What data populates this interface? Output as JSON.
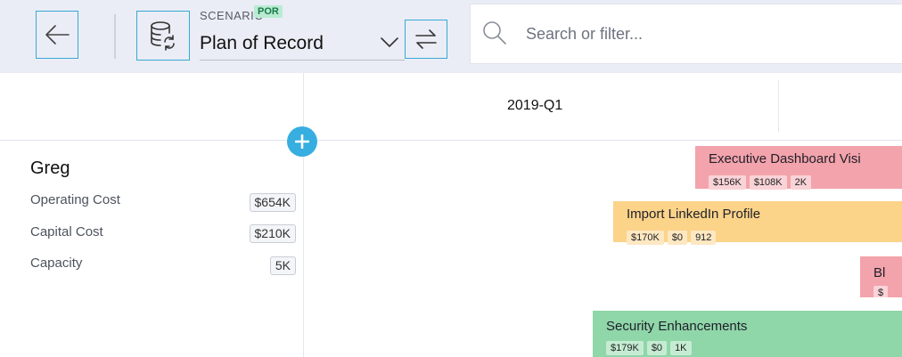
{
  "toolbar": {
    "scenario_label": "SCENARIO",
    "scenario_badge": "POR",
    "scenario_name": "Plan of Record"
  },
  "search": {
    "placeholder": "Search or filter..."
  },
  "timeline": {
    "quarter": "2019-Q1"
  },
  "summary": {
    "owner": "Greg",
    "metrics": [
      {
        "label": "Operating Cost",
        "value": "$654K"
      },
      {
        "label": "Capital Cost",
        "value": "$210K"
      },
      {
        "label": "Capacity",
        "value": "5K"
      }
    ]
  },
  "bars": [
    {
      "title": "Executive Dashboard Visi",
      "color": "#f3a3ab",
      "chips": [
        "$156K",
        "$108K",
        "2K"
      ]
    },
    {
      "title": "Import LinkedIn Profile",
      "color": "#fbd389",
      "chips": [
        "$170K",
        "$0",
        "912"
      ]
    },
    {
      "title": "Bl",
      "color": "#f3a3ab",
      "chips": [
        "$"
      ]
    },
    {
      "title": "Security Enhancements",
      "color": "#8fd6a8",
      "chips": [
        "$179K",
        "$0",
        "1K"
      ]
    }
  ],
  "icons": {
    "back": "arrow-left-icon",
    "scenario": "database-sync-icon",
    "chevron": "chevron-down-icon",
    "swap": "swap-arrows-icon",
    "search": "search-icon",
    "add": "plus-icon"
  },
  "colors": {
    "accent": "#37aee0",
    "toolbar_bg": "#eaedf5",
    "badge_bg": "#b9ebd3"
  }
}
